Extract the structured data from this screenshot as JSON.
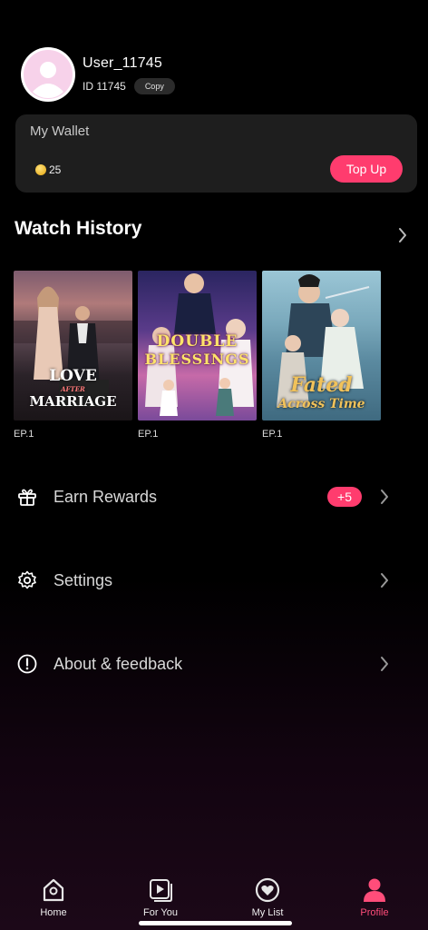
{
  "profile": {
    "username": "User_11745",
    "id_label": "ID 11745",
    "copy_label": "Copy"
  },
  "wallet": {
    "title": "My Wallet",
    "coins": "25",
    "topup_label": "Top Up"
  },
  "history": {
    "title": "Watch History",
    "items": [
      {
        "title_main": "LOVE",
        "title_small": "AFTER",
        "title_sub": "MARRIAGE",
        "episode": "EP.1"
      },
      {
        "title_main": "DOUBLE",
        "title_sub": "BLESSINGS",
        "episode": "EP.1"
      },
      {
        "title_main": "Fated",
        "title_sub": "Across Time",
        "episode": "EP.1"
      }
    ]
  },
  "menu": {
    "earn": {
      "label": "Earn Rewards",
      "badge": "+5"
    },
    "settings": {
      "label": "Settings"
    },
    "about": {
      "label": "About & feedback"
    }
  },
  "tabs": [
    {
      "label": "Home",
      "icon": "home-icon"
    },
    {
      "label": "For You",
      "icon": "for-you-icon"
    },
    {
      "label": "My List",
      "icon": "heart-icon"
    },
    {
      "label": "Profile",
      "icon": "profile-icon"
    }
  ],
  "colors": {
    "accent": "#ff3c6e",
    "card_bg": "#1e1e1e",
    "background": "#000000"
  }
}
